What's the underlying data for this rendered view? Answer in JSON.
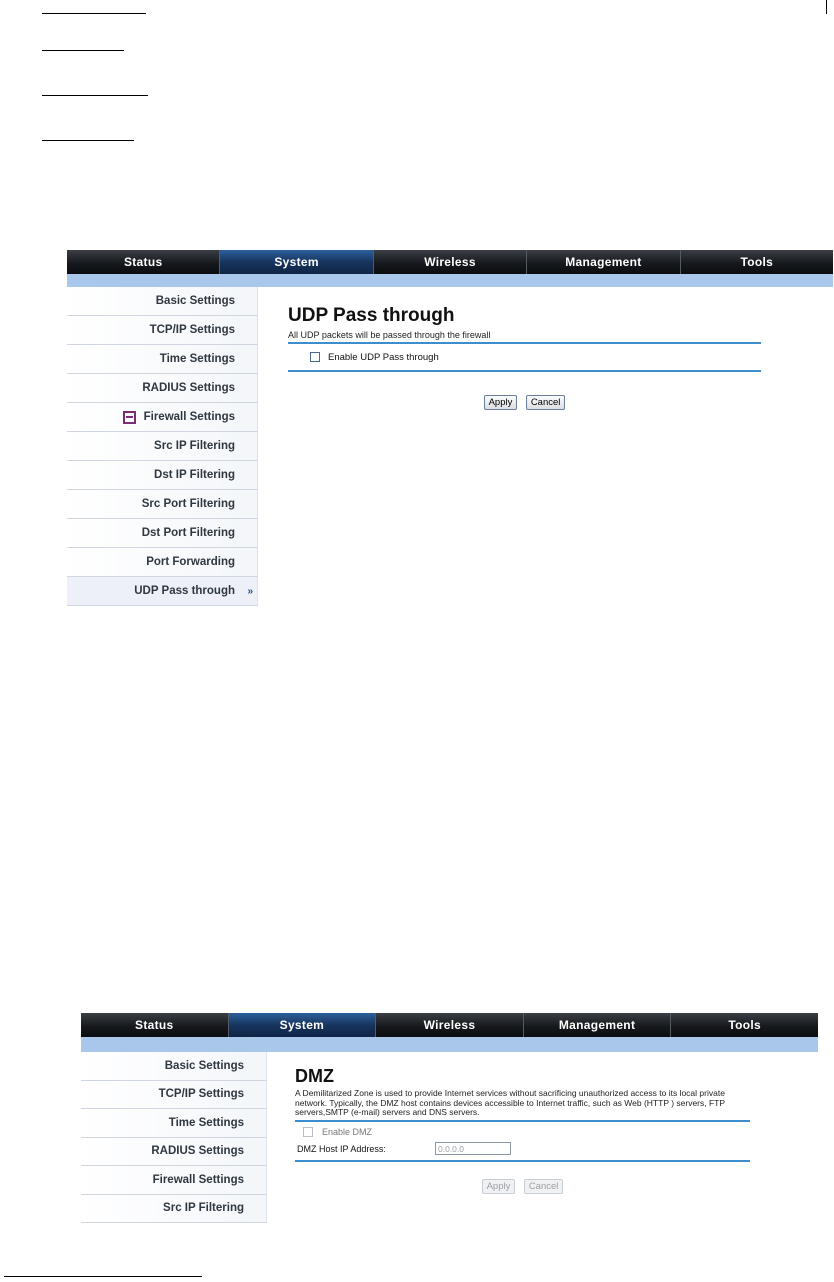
{
  "screen1": {
    "nav": {
      "tabs": [
        "Status",
        "System",
        "Wireless",
        "Management",
        "Tools"
      ],
      "active": "System"
    },
    "sidebar": {
      "items": [
        "Basic Settings",
        "TCP/IP Settings",
        "Time Settings",
        "RADIUS Settings",
        "Firewall Settings",
        "Src IP Filtering",
        "Dst IP Filtering",
        "Src Port Filtering",
        "Dst Port Filtering",
        "Port Forwarding",
        "UDP Pass through"
      ],
      "chevron": "»"
    },
    "content": {
      "title": "UDP Pass through",
      "description": "All UDP packets will be passed through the firewall",
      "checkbox_label": "Enable UDP Pass through",
      "apply_label": "Apply",
      "cancel_label": "Cancel"
    }
  },
  "screen2": {
    "nav": {
      "tabs": [
        "Status",
        "System",
        "Wireless",
        "Management",
        "Tools"
      ],
      "active": "System"
    },
    "sidebar": {
      "items": [
        "Basic Settings",
        "TCP/IP Settings",
        "Time Settings",
        "RADIUS Settings",
        "Firewall Settings",
        "Src IP Filtering"
      ]
    },
    "content": {
      "title": "DMZ",
      "description": "A Demilitarized Zone is used to provide Internet services without sacrificing unauthorized access to its local private network. Typically, the DMZ host contains devices accessible to Internet traffic, such as Web (HTTP ) servers, FTP servers,SMTP (e-mail) servers and DNS servers.",
      "checkbox_label": "Enable DMZ",
      "host_label": "DMZ Host IP Address:",
      "host_value": "0.0.0.0",
      "apply_label": "Apply",
      "cancel_label": "Cancel"
    }
  },
  "colors": {
    "nav_dark": "#16191d",
    "nav_active": "#17355e",
    "subbar": "#a9c7ea",
    "rule": "#3d8ecf",
    "firewall_marker": "#7a2d76"
  }
}
